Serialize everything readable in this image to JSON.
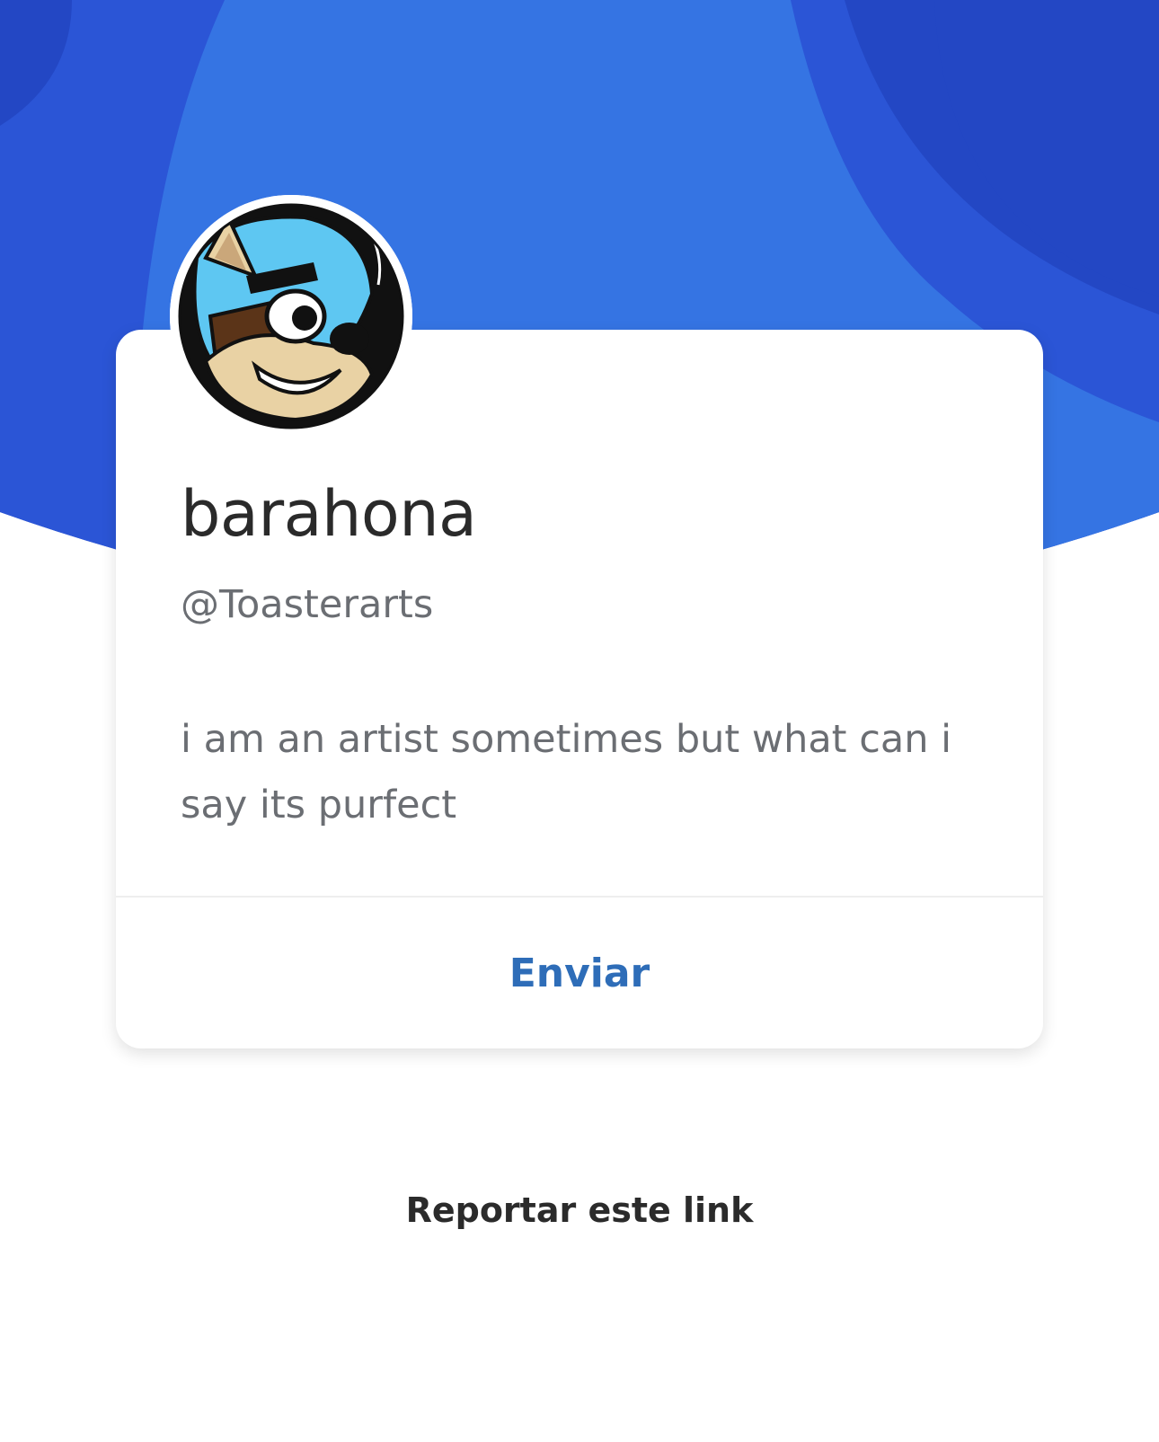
{
  "theme": {
    "hero_blue_dark": "#2347c4",
    "hero_blue_mid": "#2b55d6",
    "hero_blue_light": "#3574e3",
    "link_color": "#2e6db8"
  },
  "profile": {
    "avatar_icon": "cartoon-fox-avatar",
    "display_name": "barahona",
    "handle": "@Toasterarts",
    "bio": "i am an artist sometimes but what can i say its purfect"
  },
  "actions": {
    "send_label": "Enviar",
    "report_label": "Reportar este link"
  }
}
